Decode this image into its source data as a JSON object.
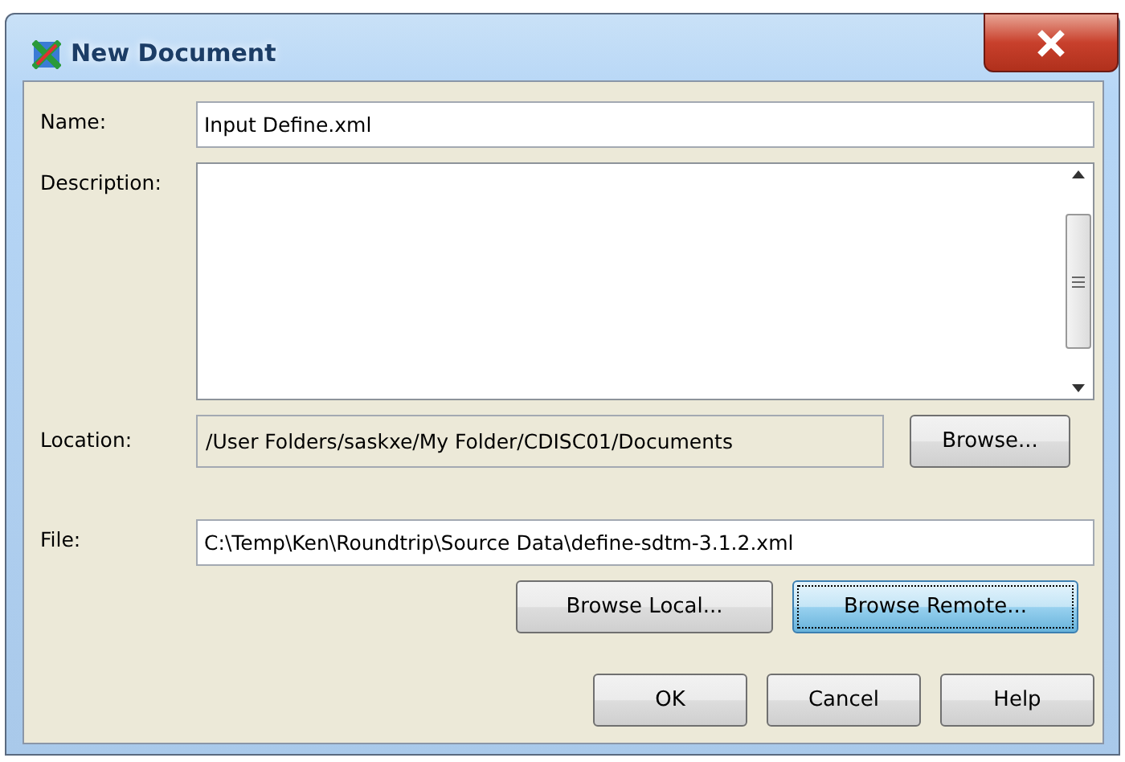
{
  "window": {
    "title": "New Document"
  },
  "name": {
    "label": "Name:",
    "value": "Input Define.xml"
  },
  "description": {
    "label": "Description:"
  },
  "location": {
    "label": "Location:",
    "value": "/User Folders/saskxe/My Folder/CDISC01/Documents",
    "button": "Browse..."
  },
  "file": {
    "label": "File:",
    "value": "C:\\Temp\\Ken\\Roundtrip\\Source Data\\define-sdtm-3.1.2.xml"
  },
  "file_buttons": [
    {
      "label": "Browse Local...",
      "focused": false
    },
    {
      "label": "Browse Remote...",
      "focused": true
    }
  ],
  "buttons": [
    {
      "label": "OK",
      "focused": false
    },
    {
      "label": "Cancel",
      "focused": false
    },
    {
      "label": "Help",
      "focused": false
    }
  ]
}
